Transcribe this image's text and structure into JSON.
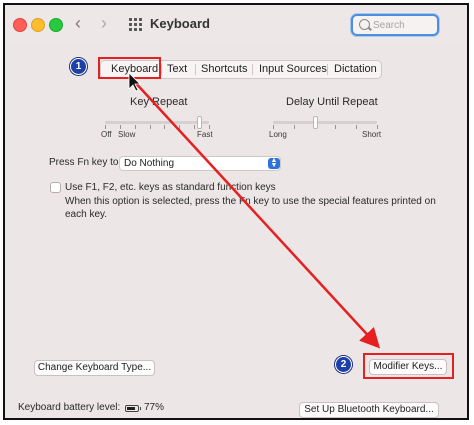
{
  "window": {
    "title": "Keyboard",
    "search_placeholder": "Search"
  },
  "tabs": [
    {
      "label": "Keyboard",
      "selected": true
    },
    {
      "label": "Text"
    },
    {
      "label": "Shortcuts"
    },
    {
      "label": "Input Sources"
    },
    {
      "label": "Dictation"
    }
  ],
  "key_repeat": {
    "label": "Key Repeat",
    "min_label": "Off",
    "min2_label": "Slow",
    "max_label": "Fast",
    "value_fraction": 0.9
  },
  "delay_until_repeat": {
    "label": "Delay Until Repeat",
    "min_label": "Long",
    "max_label": "Short",
    "value_fraction": 0.4
  },
  "fn_key": {
    "label": "Press Fn key to",
    "selected_option": "Do Nothing"
  },
  "function_keys_option": {
    "label": "Use F1, F2, etc. keys as standard function keys",
    "checked": false,
    "description": "When this option is selected, press the Fn key to use the special features printed on each key."
  },
  "buttons": {
    "change_keyboard_type": "Change Keyboard Type...",
    "modifier_keys": "Modifier Keys...",
    "bluetooth_keyboard": "Set Up Bluetooth Keyboard..."
  },
  "battery": {
    "label": "Keyboard battery level:",
    "percent_text": "77%",
    "level_fraction": 0.77
  },
  "annotations": {
    "badge_1": "1",
    "badge_2": "2",
    "highlight_color": "#e52020",
    "badge_color": "#1f3fa8"
  },
  "colors": {
    "accent": "#2e73db",
    "window_bg": "#ece6e6"
  }
}
